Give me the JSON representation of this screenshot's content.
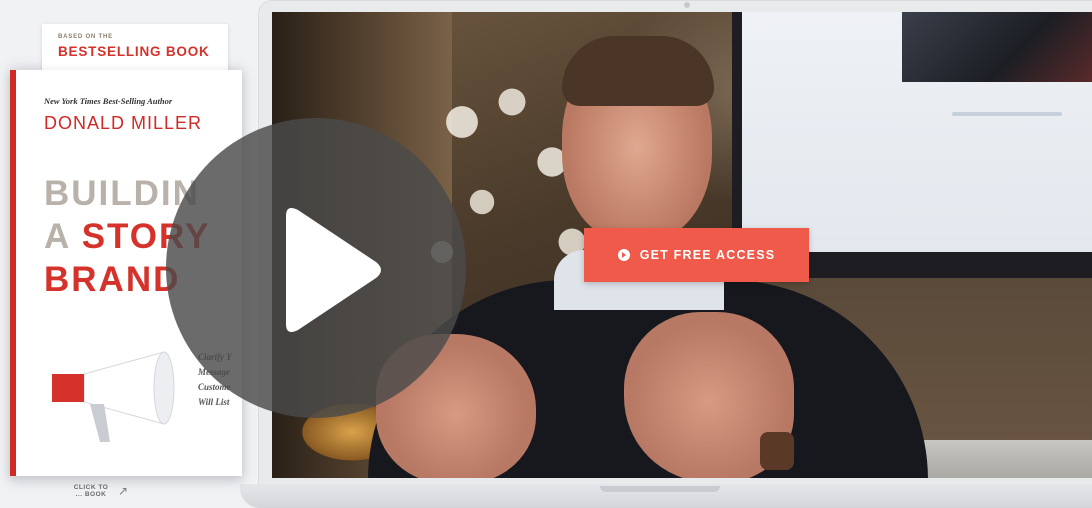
{
  "book": {
    "tag_small": "BASED ON THE",
    "tag_big": "BESTSELLING BOOK",
    "kicker": "New York Times Best-Selling Author",
    "author": "DONALD MILLER",
    "title_line1": "BUILDIN",
    "title_line2_a": "A ",
    "title_line2_b": "STORY",
    "title_line3": "BRAND",
    "subtitle": "Clarify Y\nMessage\nCustome\nWill List",
    "click_hint": "CLICK TO\n... BOOK"
  },
  "video": {
    "cta_label": "GET FREE ACCESS"
  },
  "colors": {
    "brand_red": "#d4322a",
    "cta_coral": "#ef5a4a",
    "play_overlay": "#4b4b4b"
  },
  "icons": {
    "play": "play-icon",
    "cta": "play-circle-icon",
    "megaphone": "megaphone-icon",
    "arrow": "curved-arrow-icon"
  }
}
